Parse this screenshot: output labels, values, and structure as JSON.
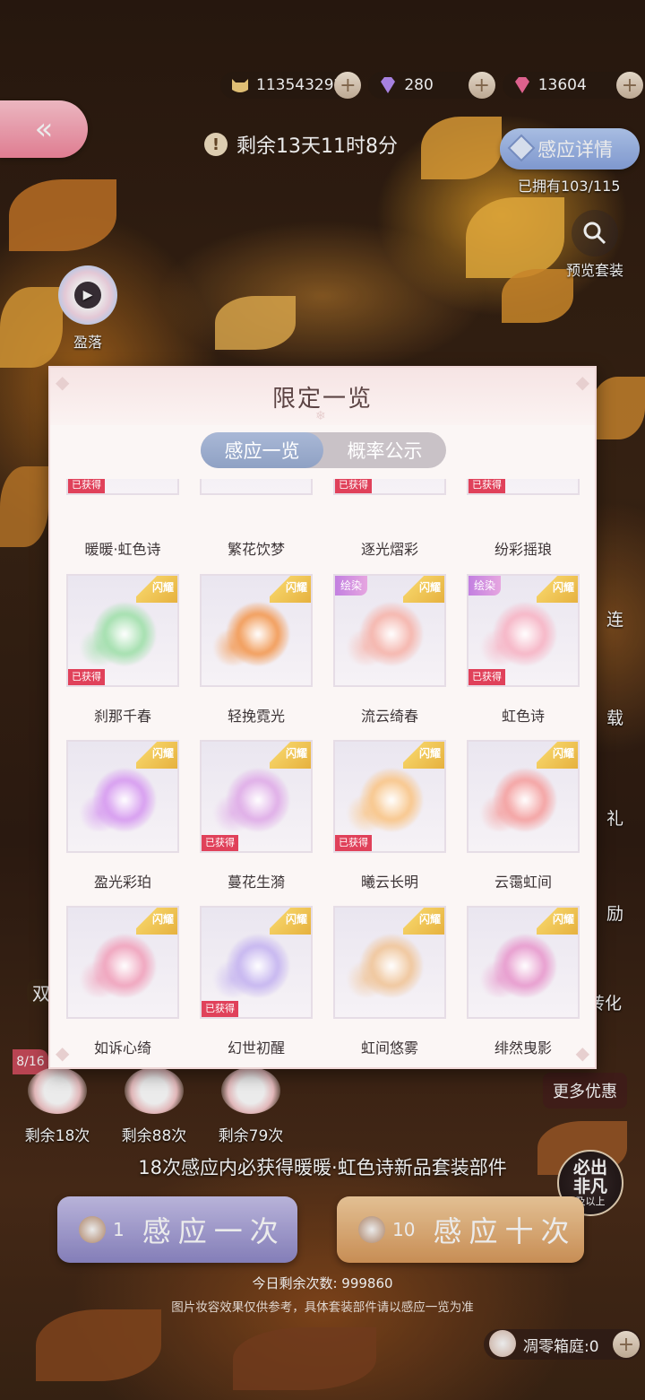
{
  "currency": {
    "gold": "113543292",
    "diamond_purple": "280",
    "diamond_pink": "13604"
  },
  "event": {
    "remaining_time": "剩余13天11时8分",
    "detail_button": "感应详情",
    "owned_count": "已拥有103/115",
    "preview_label": "预览套装",
    "play_label": "盈落"
  },
  "side_menu": [
    "连",
    "载",
    "礼",
    "励",
    "转化"
  ],
  "more_offers": "更多优惠",
  "stack_counter": "8/16",
  "side_fragment": "双",
  "remains": [
    {
      "label": "剩余18次"
    },
    {
      "label": "剩余88次"
    },
    {
      "label": "剩余79次"
    }
  ],
  "guarantee_text": "18次感应内必获得暖暖·虹色诗新品套装部件",
  "badge": {
    "line1": "必出",
    "line2": "非凡",
    "line3": "及以上"
  },
  "draw": {
    "one": {
      "count": "1",
      "label": "感应一次"
    },
    "ten": {
      "count": "10",
      "label": "感应十次"
    }
  },
  "daily_remaining": "今日剩余次数: 999860",
  "disclaimer": "图片妆容效果仅供参考，具体套装部件请以感应一览为准",
  "garden": "凋零箱庭:0",
  "modal": {
    "title": "限定一览",
    "tabs": [
      "感应一览",
      "概率公示"
    ],
    "tag_owned": "已获得",
    "tag_shine": "闪耀",
    "tag_dye": "绘染",
    "items": [
      {
        "name": "暖暖·虹色诗",
        "owned": true,
        "shine": true,
        "dye": false,
        "hue": "#f6a0b8"
      },
      {
        "name": "繁花饮梦",
        "owned": false,
        "shine": false,
        "dye": false,
        "hue": "#f38a6a"
      },
      {
        "name": "逐光熠彩",
        "owned": true,
        "shine": false,
        "dye": false,
        "hue": "#7fd0d8"
      },
      {
        "name": "纷彩摇琅",
        "owned": true,
        "shine": false,
        "dye": false,
        "hue": "#e07ac8"
      },
      {
        "name": "刹那千春",
        "owned": true,
        "shine": true,
        "dye": false,
        "hue": "#a6e0b0"
      },
      {
        "name": "轻挽霓光",
        "owned": false,
        "shine": true,
        "dye": false,
        "hue": "#f2a060"
      },
      {
        "name": "流云绮春",
        "owned": false,
        "shine": true,
        "dye": true,
        "hue": "#f5b8b0"
      },
      {
        "name": "虹色诗",
        "owned": true,
        "shine": true,
        "dye": true,
        "hue": "#f6b8c8"
      },
      {
        "name": "盈光彩珀",
        "owned": false,
        "shine": true,
        "dye": false,
        "hue": "#d8a0f0"
      },
      {
        "name": "蔓花生漪",
        "owned": true,
        "shine": true,
        "dye": false,
        "hue": "#e0b0e8"
      },
      {
        "name": "曦云长明",
        "owned": true,
        "shine": true,
        "dye": false,
        "hue": "#f8c890"
      },
      {
        "name": "云霭虹间",
        "owned": false,
        "shine": true,
        "dye": false,
        "hue": "#f4a6a6"
      },
      {
        "name": "如诉心绮",
        "owned": false,
        "shine": true,
        "dye": false,
        "hue": "#f0a8c0"
      },
      {
        "name": "幻世初醒",
        "owned": true,
        "shine": true,
        "dye": false,
        "hue": "#c8b8f0"
      },
      {
        "name": "虹间悠雾",
        "owned": false,
        "shine": true,
        "dye": false,
        "hue": "#f0c8a0"
      },
      {
        "name": "绯然曳影",
        "owned": false,
        "shine": true,
        "dye": false,
        "hue": "#e8a0d0"
      }
    ]
  }
}
